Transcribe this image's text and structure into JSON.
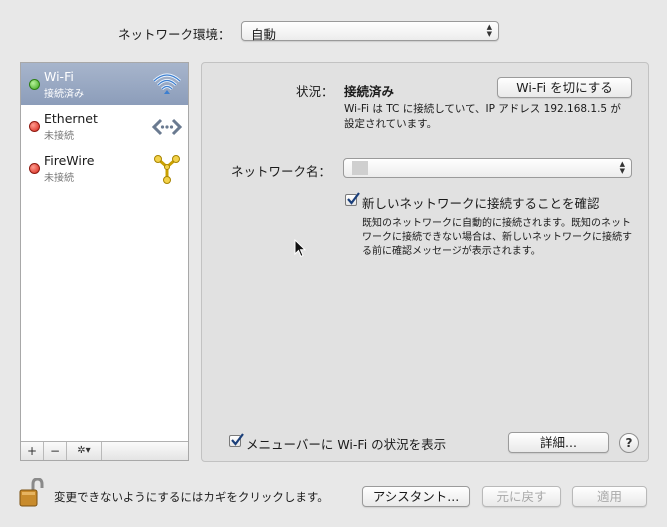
{
  "location": {
    "label": "ネットワーク環境：",
    "value": "自動"
  },
  "sidebar": {
    "services": [
      {
        "name": "Wi-Fi",
        "status": "接続済み",
        "status_color": "green",
        "selected": true,
        "icon": "wifi-icon"
      },
      {
        "name": "Ethernet",
        "status": "未接続",
        "status_color": "red",
        "selected": false,
        "icon": "ethernet-icon"
      },
      {
        "name": "FireWire",
        "status": "未接続",
        "status_color": "red",
        "selected": false,
        "icon": "firewire-icon"
      }
    ],
    "add_label": "+",
    "remove_label": "−",
    "action_label": "✲▾"
  },
  "detail": {
    "status_label": "状況：",
    "status_value": "接続済み",
    "wifi_off_button": "Wi-Fi を切にする",
    "status_desc_1": "Wi-Fi は TC に接続していて、IP アドレス 192.168.1.5 が",
    "status_desc_2": "設定されています。",
    "network_name_label": "ネットワーク名：",
    "network_name_value": "",
    "ask_join_label": "新しいネットワークに接続することを確認",
    "ask_join_checked": true,
    "ask_join_desc_1": "既知のネットワークに自動的に接続されます。既知のネット",
    "ask_join_desc_2": "ワークに接続できない場合は、新しいネットワークに接続す",
    "ask_join_desc_3": "る前に確認メッセージが表示されます。",
    "show_menubar_label": "メニューバーに Wi-Fi の状況を表示",
    "show_menubar_checked": true,
    "advanced_button": "詳細...",
    "help_label": "?"
  },
  "footer": {
    "lock_text": "変更できないようにするにはカギをクリックします。",
    "assistant_button": "アシスタント...",
    "revert_button": "元に戻す",
    "apply_button": "適用"
  },
  "colors": {
    "selection": "#8c9dba",
    "panel": "#e1e1e1",
    "window": "#e8e8e8",
    "check": "#1b3f7a"
  }
}
